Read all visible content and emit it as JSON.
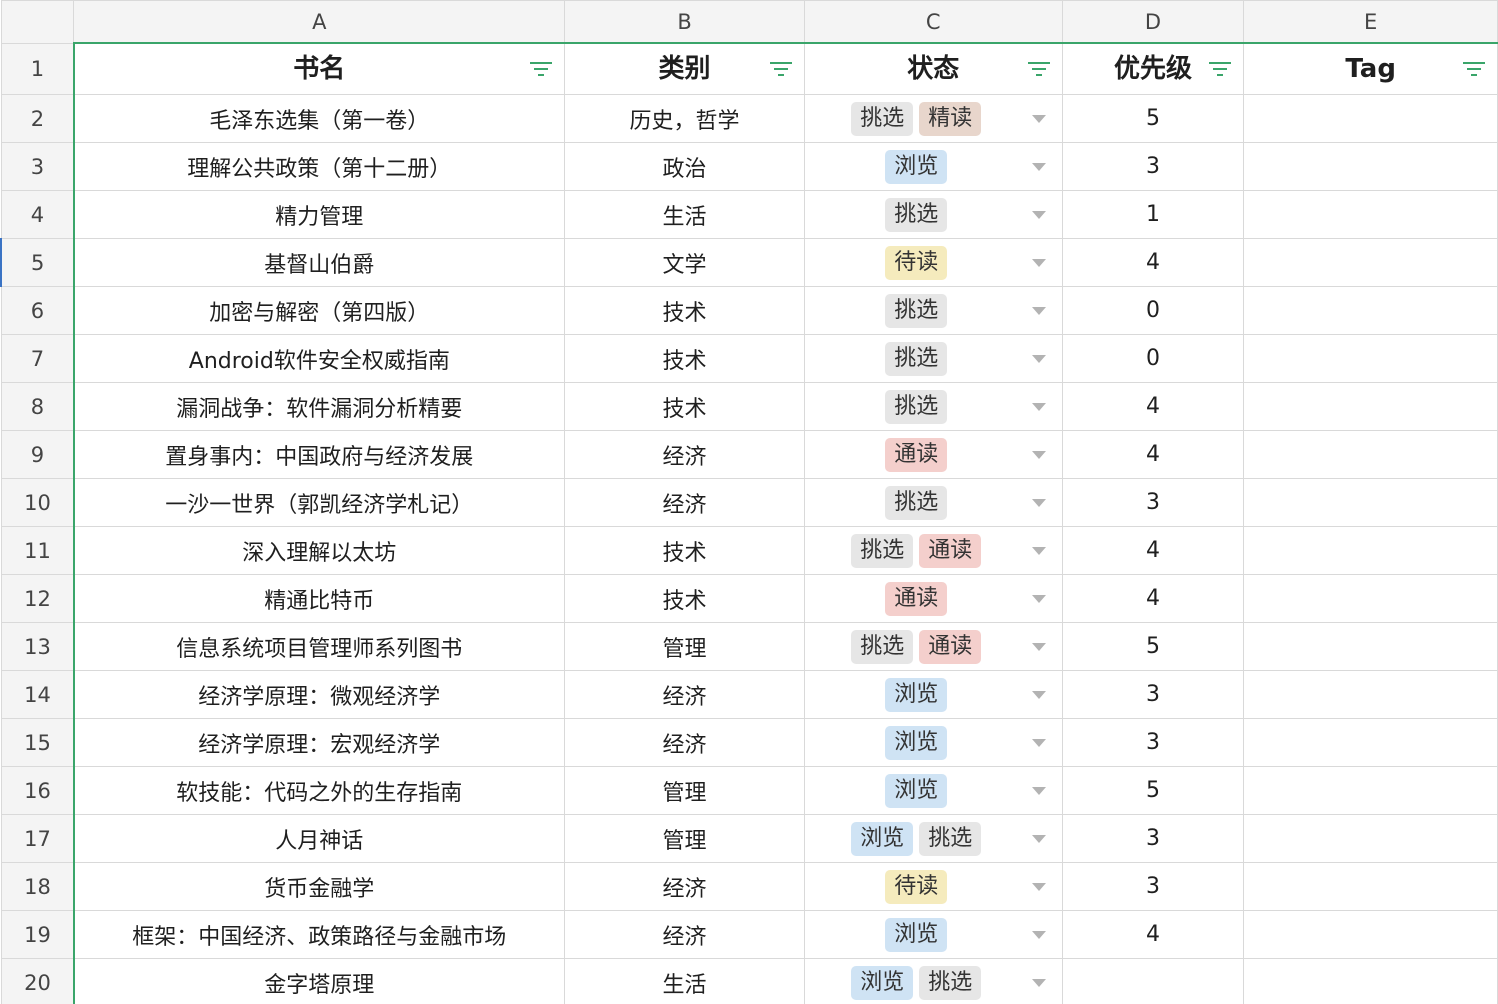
{
  "columns": [
    "A",
    "B",
    "C",
    "D",
    "E"
  ],
  "headers": {
    "name": "书名",
    "category": "类别",
    "status": "状态",
    "priority": "优先级",
    "tag": "Tag"
  },
  "colors": {
    "挑选": "#e6e6e6",
    "精读": "#e8d6cc",
    "浏览": "#cfe3f4",
    "待读": "#f5ebbd",
    "通读": "#f4cfcc"
  },
  "rows": [
    {
      "num": "2",
      "name": "毛泽东选集（第一卷）",
      "category": "历史，哲学",
      "status": [
        "挑选",
        "精读"
      ],
      "priority": "5"
    },
    {
      "num": "3",
      "name": "理解公共政策（第十二册）",
      "category": "政治",
      "status": [
        "浏览"
      ],
      "priority": "3"
    },
    {
      "num": "4",
      "name": "精力管理",
      "category": "生活",
      "status": [
        "挑选"
      ],
      "priority": "1"
    },
    {
      "num": "5",
      "name": "基督山伯爵",
      "category": "文学",
      "status": [
        "待读"
      ],
      "priority": "4"
    },
    {
      "num": "6",
      "name": "加密与解密（第四版）",
      "category": "技术",
      "status": [
        "挑选"
      ],
      "priority": "0"
    },
    {
      "num": "7",
      "name": "Android软件安全权威指南",
      "category": "技术",
      "status": [
        "挑选"
      ],
      "priority": "0"
    },
    {
      "num": "8",
      "name": "漏洞战争：软件漏洞分析精要",
      "category": "技术",
      "status": [
        "挑选"
      ],
      "priority": "4"
    },
    {
      "num": "9",
      "name": "置身事内：中国政府与经济发展",
      "category": "经济",
      "status": [
        "通读"
      ],
      "priority": "4"
    },
    {
      "num": "10",
      "name": "一沙一世界（郭凯经济学札记）",
      "category": "经济",
      "status": [
        "挑选"
      ],
      "priority": "3"
    },
    {
      "num": "11",
      "name": "深入理解以太坊",
      "category": "技术",
      "status": [
        "挑选",
        "通读"
      ],
      "priority": "4"
    },
    {
      "num": "12",
      "name": "精通比特币",
      "category": "技术",
      "status": [
        "通读"
      ],
      "priority": "4"
    },
    {
      "num": "13",
      "name": "信息系统项目管理师系列图书",
      "category": "管理",
      "status": [
        "挑选",
        "通读"
      ],
      "priority": "5"
    },
    {
      "num": "14",
      "name": "经济学原理：微观经济学",
      "category": "经济",
      "status": [
        "浏览"
      ],
      "priority": "3"
    },
    {
      "num": "15",
      "name": "经济学原理：宏观经济学",
      "category": "经济",
      "status": [
        "浏览"
      ],
      "priority": "3"
    },
    {
      "num": "16",
      "name": "软技能：代码之外的生存指南",
      "category": "管理",
      "status": [
        "浏览"
      ],
      "priority": "5"
    },
    {
      "num": "17",
      "name": "人月神话",
      "category": "管理",
      "status": [
        "浏览",
        "挑选"
      ],
      "priority": "3"
    },
    {
      "num": "18",
      "name": "货币金融学",
      "category": "经济",
      "status": [
        "待读"
      ],
      "priority": "3"
    },
    {
      "num": "19",
      "name": "框架：中国经济、政策路径与金融市场",
      "category": "经济",
      "status": [
        "浏览"
      ],
      "priority": "4"
    },
    {
      "num": "20",
      "name": "金字塔原理",
      "category": "生活",
      "status": [
        "浏览",
        "挑选"
      ],
      "priority": ""
    }
  ]
}
